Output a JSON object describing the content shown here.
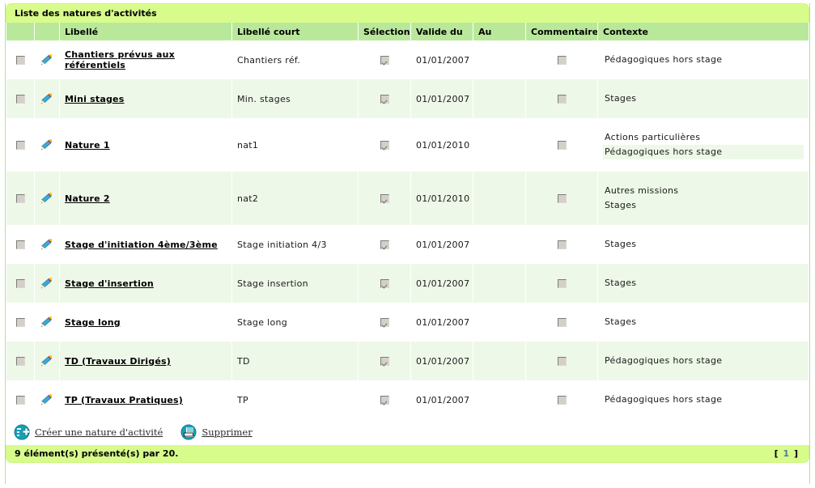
{
  "panel": {
    "title": "Liste des natures d'activités"
  },
  "table": {
    "columns": [
      {
        "key": "check",
        "label": ""
      },
      {
        "key": "edit",
        "label": ""
      },
      {
        "key": "lib",
        "label": "Libellé"
      },
      {
        "key": "short",
        "label": "Libellé court"
      },
      {
        "key": "sel",
        "label": "Sélection"
      },
      {
        "key": "du",
        "label": "Valide du"
      },
      {
        "key": "au",
        "label": "Au"
      },
      {
        "key": "com",
        "label": "Commentaire"
      },
      {
        "key": "ctx",
        "label": "Contexte"
      }
    ],
    "rows": [
      {
        "checked": false,
        "edit_icon": "pencil-icon",
        "libelle": "Chantiers prévus aux référentiels",
        "libelle_court": "Chantiers réf.",
        "selection": true,
        "valide_du": "01/01/2007",
        "au": "",
        "commentaire": false,
        "contexte": [
          "Pédagogiques hors stage"
        ]
      },
      {
        "checked": false,
        "edit_icon": "pencil-icon",
        "libelle": "Mini stages",
        "libelle_court": "Min. stages",
        "selection": true,
        "valide_du": "01/01/2007",
        "au": "",
        "commentaire": false,
        "contexte": [
          "Stages"
        ]
      },
      {
        "checked": false,
        "edit_icon": "pencil-icon",
        "libelle": "Nature 1",
        "libelle_court": "nat1",
        "selection": true,
        "valide_du": "01/01/2010",
        "au": "",
        "commentaire": false,
        "contexte": [
          "Actions particulières",
          "Pédagogiques hors stage"
        ]
      },
      {
        "checked": false,
        "edit_icon": "pencil-icon",
        "libelle": "Nature 2",
        "libelle_court": "nat2",
        "selection": true,
        "valide_du": "01/01/2010",
        "au": "",
        "commentaire": false,
        "contexte": [
          "Autres missions",
          "Stages"
        ]
      },
      {
        "checked": false,
        "edit_icon": "pencil-icon",
        "libelle": "Stage d'initiation 4ème/3ème",
        "libelle_court": "Stage initiation 4/3",
        "selection": true,
        "valide_du": "01/01/2007",
        "au": "",
        "commentaire": false,
        "contexte": [
          "Stages"
        ]
      },
      {
        "checked": false,
        "edit_icon": "pencil-icon",
        "libelle": "Stage d'insertion",
        "libelle_court": "Stage insertion",
        "selection": true,
        "valide_du": "01/01/2007",
        "au": "",
        "commentaire": false,
        "contexte": [
          "Stages"
        ]
      },
      {
        "checked": false,
        "edit_icon": "pencil-icon",
        "libelle": "Stage long",
        "libelle_court": "Stage long",
        "selection": true,
        "valide_du": "01/01/2007",
        "au": "",
        "commentaire": false,
        "contexte": [
          "Stages"
        ]
      },
      {
        "checked": false,
        "edit_icon": "pencil-icon",
        "libelle": "TD (Travaux Dirigés)",
        "libelle_court": "TD",
        "selection": true,
        "valide_du": "01/01/2007",
        "au": "",
        "commentaire": false,
        "contexte": [
          "Pédagogiques hors stage"
        ]
      },
      {
        "checked": false,
        "edit_icon": "pencil-icon",
        "libelle": "TP (Travaux Pratiques)",
        "libelle_court": "TP",
        "selection": true,
        "valide_du": "01/01/2007",
        "au": "",
        "commentaire": false,
        "contexte": [
          "Pédagogiques hors stage"
        ]
      }
    ]
  },
  "actions": [
    {
      "icon": "add-circle-icon",
      "label": "Créer une nature d'activité"
    },
    {
      "icon": "delete-circle-icon",
      "label": "Supprimer"
    }
  ],
  "footer": {
    "status": "9 élément(s) présenté(s) par 20.",
    "pager_open": "[",
    "pager_page": "1",
    "pager_close": "]"
  },
  "colors": {
    "title_bar": "#d8fc8c",
    "header_row": "#bae89b",
    "alt_row": "#eef8e8",
    "panel_border": "#b5e08f",
    "action_icon": "#16a0b4",
    "pager_number": "#4f7a9a"
  }
}
